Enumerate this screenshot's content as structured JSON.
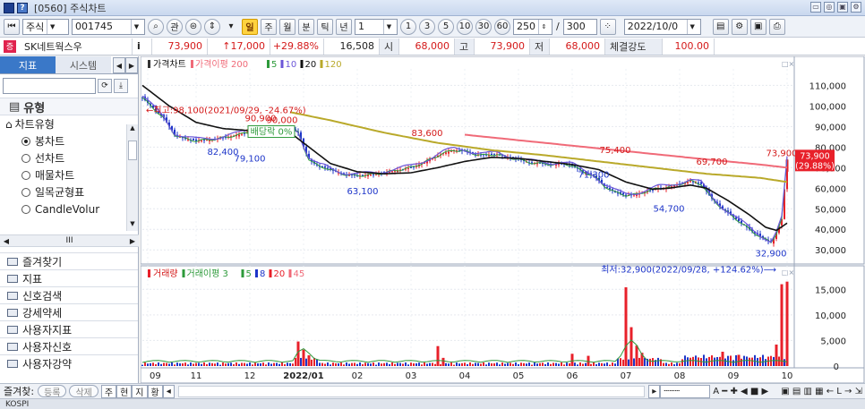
{
  "window": {
    "title": "[0560] 주식차트"
  },
  "toolbar": {
    "market": "주식",
    "code": "001745",
    "btn_gwan": "관",
    "period_hot": "일",
    "periods": [
      "주",
      "월",
      "분",
      "틱",
      "년"
    ],
    "count": "1",
    "minutes": [
      "1",
      "3",
      "5",
      "10",
      "30",
      "60"
    ],
    "bars": "250",
    "slash": "/",
    "total": "300",
    "date": "2022/10/0"
  },
  "quote": {
    "badge": "증",
    "name": "SK네트웍스우",
    "info": "i",
    "price": "73,900",
    "change": "↑17,000",
    "rate": "+29.88%",
    "volume": "16,508",
    "open_label": "시",
    "open": "68,000",
    "high_label": "고",
    "high": "73,900",
    "low_label": "저",
    "low": "68,000",
    "strength_label": "체결강도",
    "strength": "100.00"
  },
  "left_panel": {
    "tab_active": "지표",
    "tab_inactive": "시스템",
    "section": "유형",
    "tree_node": "차트유형",
    "chart_types": [
      {
        "label": "봉차트",
        "selected": true
      },
      {
        "label": "선차트",
        "selected": false
      },
      {
        "label": "매물차트",
        "selected": false
      },
      {
        "label": "일목균형표",
        "selected": false
      },
      {
        "label": "CandleVolur",
        "selected": false
      }
    ],
    "scroll_mid": "III",
    "folders": [
      "즐겨찾기",
      "지표",
      "신호검색",
      "강세약세",
      "사용자지표",
      "사용자신호",
      "사용자강약"
    ]
  },
  "bottom": {
    "label": "즐겨찾:",
    "register": "등록",
    "delete": "삭제",
    "tabs": [
      "주",
      "현",
      "지",
      "황"
    ]
  },
  "status": {
    "text": "KOSPI"
  },
  "colors": {
    "up": "#e8202a",
    "down": "#1d35c9",
    "ma5": "#2d9a3a",
    "ma10": "#6b56d8",
    "ma20": "#111111",
    "ma120": "#b9a92a",
    "ma200": "#f06a78"
  },
  "chart_data": [
    {
      "type": "line",
      "title": "가격차트",
      "legend": [
        {
          "name": "가격차트",
          "color": "#e8202a"
        },
        {
          "name": "가격이평 200",
          "color": "#f06a78"
        },
        {
          "name": "5",
          "color": "#2d9a3a"
        },
        {
          "name": "10",
          "color": "#6b56d8"
        },
        {
          "name": "20",
          "color": "#111111"
        },
        {
          "name": "120",
          "color": "#b9a92a"
        }
      ],
      "x_ticks": [
        "09",
        "11",
        "12",
        "2022/01",
        "02",
        "03",
        "04",
        "05",
        "06",
        "07",
        "08",
        "09",
        "10"
      ],
      "y_ticks": [
        30000,
        40000,
        50000,
        60000,
        70000,
        80000,
        90000,
        100000,
        110000
      ],
      "ylim": [
        24000,
        118000
      ],
      "price_series": [
        [
          0,
          104000
        ],
        [
          4,
          99000
        ],
        [
          8,
          94000
        ],
        [
          12,
          86000
        ],
        [
          16,
          84000
        ],
        [
          20,
          83000
        ],
        [
          24,
          83500
        ],
        [
          28,
          84000
        ],
        [
          32,
          85000
        ],
        [
          36,
          86000
        ],
        [
          40,
          87500
        ],
        [
          44,
          88500
        ],
        [
          48,
          89000
        ],
        [
          52,
          88000
        ],
        [
          56,
          88500
        ],
        [
          58,
          87000
        ],
        [
          60,
          80000
        ],
        [
          62,
          74000
        ],
        [
          64,
          72000
        ],
        [
          66,
          70500
        ],
        [
          68,
          70000
        ],
        [
          72,
          68000
        ],
        [
          76,
          66500
        ],
        [
          80,
          66000
        ],
        [
          84,
          66500
        ],
        [
          88,
          67000
        ],
        [
          92,
          68000
        ],
        [
          96,
          69000
        ],
        [
          100,
          70000
        ],
        [
          104,
          72000
        ],
        [
          108,
          74500
        ],
        [
          112,
          77000
        ],
        [
          116,
          78500
        ],
        [
          120,
          78000
        ],
        [
          124,
          76500
        ],
        [
          128,
          76000
        ],
        [
          132,
          76500
        ],
        [
          136,
          75000
        ],
        [
          140,
          74000
        ],
        [
          144,
          72500
        ],
        [
          148,
          72000
        ],
        [
          152,
          71500
        ],
        [
          156,
          72000
        ],
        [
          160,
          71000
        ],
        [
          164,
          68000
        ],
        [
          168,
          66000
        ],
        [
          172,
          61000
        ],
        [
          176,
          58000
        ],
        [
          180,
          56500
        ],
        [
          184,
          57000
        ],
        [
          188,
          58500
        ],
        [
          192,
          60000
        ],
        [
          196,
          60500
        ],
        [
          200,
          62000
        ],
        [
          204,
          63500
        ],
        [
          208,
          62000
        ],
        [
          212,
          55000
        ],
        [
          216,
          50000
        ],
        [
          220,
          46000
        ],
        [
          224,
          42000
        ],
        [
          228,
          38000
        ],
        [
          232,
          35000
        ],
        [
          234,
          33500
        ],
        [
          236,
          38000
        ],
        [
          238,
          45000
        ],
        [
          240,
          73900
        ]
      ],
      "ma20_series": [
        [
          0,
          110000
        ],
        [
          10,
          100000
        ],
        [
          20,
          92000
        ],
        [
          30,
          89000
        ],
        [
          40,
          88000
        ],
        [
          50,
          88000
        ],
        [
          56,
          86000
        ],
        [
          62,
          80000
        ],
        [
          70,
          72000
        ],
        [
          80,
          68000
        ],
        [
          90,
          67000
        ],
        [
          100,
          67500
        ],
        [
          110,
          70000
        ],
        [
          120,
          73000
        ],
        [
          130,
          75000
        ],
        [
          140,
          74500
        ],
        [
          150,
          73000
        ],
        [
          160,
          71500
        ],
        [
          170,
          69000
        ],
        [
          180,
          63000
        ],
        [
          190,
          59500
        ],
        [
          196,
          60000
        ],
        [
          204,
          61500
        ],
        [
          210,
          60000
        ],
        [
          218,
          54000
        ],
        [
          226,
          47000
        ],
        [
          232,
          41000
        ],
        [
          236,
          39500
        ],
        [
          240,
          43000
        ]
      ],
      "ma120_series": [
        [
          55,
          97000
        ],
        [
          70,
          93000
        ],
        [
          90,
          87000
        ],
        [
          110,
          82000
        ],
        [
          130,
          78500
        ],
        [
          150,
          76000
        ],
        [
          170,
          73000
        ],
        [
          190,
          70000
        ],
        [
          210,
          67000
        ],
        [
          230,
          65000
        ],
        [
          240,
          63000
        ]
      ],
      "ma200_series": [
        [
          120,
          86000
        ],
        [
          150,
          82000
        ],
        [
          180,
          78000
        ],
        [
          210,
          74000
        ],
        [
          230,
          71500
        ],
        [
          240,
          70000
        ]
      ],
      "annotations": [
        {
          "text": "←최고:98,100(2021/09/29, -24.67%)",
          "x": 0,
          "y": 98100
        },
        {
          "text": "90,900",
          "x": 44,
          "y": 90900
        },
        {
          "text": "90,000",
          "x": 52,
          "y": 90000
        },
        {
          "text": "배당락 0%",
          "x": 48,
          "y": 86000
        },
        {
          "text": "82,400",
          "x": 30,
          "y": 82400
        },
        {
          "text": "79,100",
          "x": 40,
          "y": 79100
        },
        {
          "text": "83,600",
          "x": 106,
          "y": 83600
        },
        {
          "text": "63,100",
          "x": 82,
          "y": 63100
        },
        {
          "text": "75,400",
          "x": 176,
          "y": 75400
        },
        {
          "text": "71,300",
          "x": 168,
          "y": 71300
        },
        {
          "text": "69,700",
          "x": 212,
          "y": 69700
        },
        {
          "text": "73,900",
          "x": 238,
          "y": 73900
        },
        {
          "text": "54,700",
          "x": 196,
          "y": 54700
        },
        {
          "text": "32,900",
          "x": 234,
          "y": 32900
        },
        {
          "text": "최저:32,900(2022/09/28, +124.62%)⟶",
          "x": 234,
          "y": 29500
        }
      ],
      "last_price": {
        "value": "73,900",
        "rate": "(29.88%)"
      }
    },
    {
      "type": "bar",
      "title": "거래량",
      "legend": [
        {
          "name": "거래량",
          "color": "#e8202a"
        },
        {
          "name": "거래이평 3",
          "color": "#2d9a3a"
        },
        {
          "name": "5",
          "color": "#2d9a3a"
        },
        {
          "name": "8",
          "color": "#1d35c9"
        },
        {
          "name": "20",
          "color": "#e8202a"
        },
        {
          "name": "45",
          "color": "#f06a78"
        }
      ],
      "y_ticks": [
        5000,
        10000,
        15000
      ],
      "ylim": [
        0,
        17500
      ],
      "spikes": [
        {
          "x": 58,
          "value": 4800
        },
        {
          "x": 60,
          "value": 3200
        },
        {
          "x": 62,
          "value": 2100
        },
        {
          "x": 110,
          "value": 3900
        },
        {
          "x": 112,
          "value": 1600
        },
        {
          "x": 160,
          "value": 2400
        },
        {
          "x": 166,
          "value": 2000
        },
        {
          "x": 180,
          "value": 15400
        },
        {
          "x": 182,
          "value": 7600
        },
        {
          "x": 184,
          "value": 4000
        },
        {
          "x": 186,
          "value": 2600
        },
        {
          "x": 216,
          "value": 2800
        },
        {
          "x": 222,
          "value": 2200
        },
        {
          "x": 236,
          "value": 4200
        },
        {
          "x": 238,
          "value": 16000
        },
        {
          "x": 240,
          "value": 16508
        }
      ]
    }
  ]
}
